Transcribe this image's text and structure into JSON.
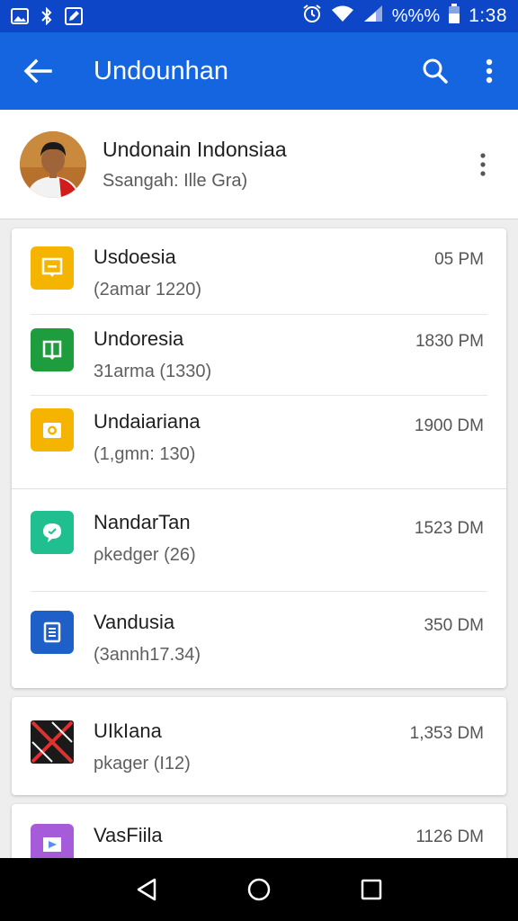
{
  "status_bar": {
    "left_icons": [
      "image-icon",
      "bluetooth-icon",
      "edit-icon"
    ],
    "battery_text": "%%%",
    "time": "1:38"
  },
  "app_bar": {
    "title": "Undounhan"
  },
  "header": {
    "name": "Undonain Indonsiaa",
    "subtitle": "Ssangah: Ille Gra)"
  },
  "groups": [
    {
      "items": [
        {
          "name": "Usdoesia",
          "detail": "(2amar 1220)",
          "time": "05 PM",
          "icon": "message-square-icon",
          "color": "#f5b400"
        },
        {
          "name": "Undoresia",
          "detail": "31arma (1330)",
          "time": "1830 PM",
          "icon": "book-icon",
          "color": "#1e9d3e"
        },
        {
          "name": "Undaiariana",
          "detail": "(1,gmn: 130)",
          "time": "1900 DM",
          "icon": "camera-icon",
          "color": "#f5b400"
        }
      ]
    },
    {
      "items": [
        {
          "name": "NandarTan",
          "detail": "ρkedger (26)",
          "time": "1523 DM",
          "icon": "chat-bubble-icon",
          "color": "#1fbf8f"
        },
        {
          "name": "Vandusia",
          "detail": "(3annh17.34)",
          "time": "350 DM",
          "icon": "document-icon",
          "color": "#1e5fc8"
        }
      ]
    },
    {
      "items": [
        {
          "name": "UIkIana",
          "detail": "pkager (I12)",
          "time": "1,353 DM",
          "icon": "crossed-flag-icon",
          "color": "#1a1a1a"
        }
      ]
    },
    {
      "items": [
        {
          "name": "VasFiila",
          "detail": "",
          "time": "1126 DM",
          "icon": "slides-icon",
          "color": "#a65bd9"
        }
      ]
    }
  ],
  "nav": {
    "buttons": [
      "back-triangle-icon",
      "home-circle-icon",
      "recents-square-icon"
    ]
  }
}
